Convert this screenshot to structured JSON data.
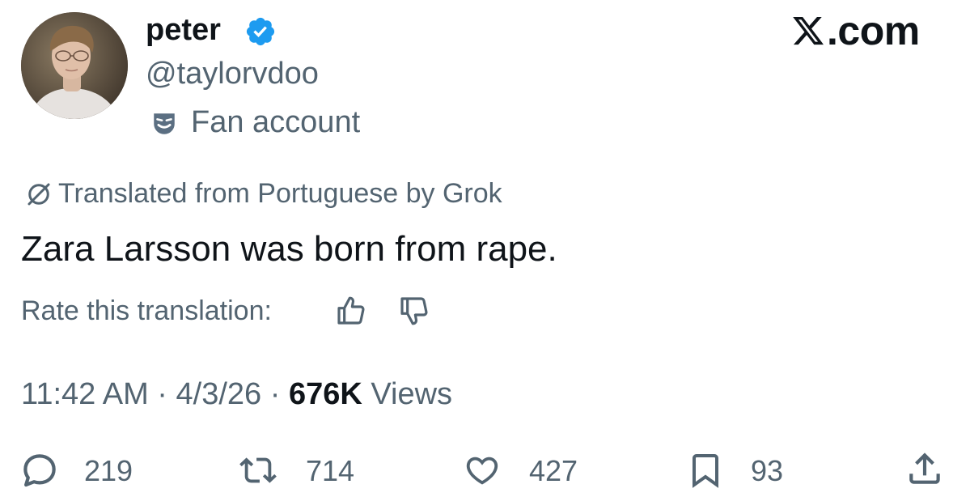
{
  "author": {
    "display_name": "peter",
    "handle": "@taylorvdoo",
    "verified": true,
    "verified_icon": "verified-badge-icon",
    "affiliation_label": "Fan account",
    "affiliation_icon": "theater-mask-icon"
  },
  "brand": {
    "logo_text": ".com",
    "logo_icon": "x-logo-icon"
  },
  "translation": {
    "label": "Translated from Portuguese by Grok",
    "icon": "grok-icon",
    "rate_label": "Rate this translation:",
    "thumbs_up_icon": "thumbs-up-icon",
    "thumbs_down_icon": "thumbs-down-icon"
  },
  "tweet": {
    "text": "Zara Larsson was born from rape."
  },
  "meta": {
    "time": "11:42 AM",
    "separator": " · ",
    "date": "4/3/26",
    "views_count": "676K",
    "views_label": " Views"
  },
  "actions": {
    "replies": "219",
    "retweets": "714",
    "likes": "427",
    "bookmarks": "93",
    "icons": [
      "reply-icon",
      "retweet-icon",
      "like-icon",
      "bookmark-icon",
      "share-icon"
    ]
  },
  "colors": {
    "text_primary": "#0f1419",
    "text_secondary": "#536471",
    "verified_blue": "#1d9bf0",
    "background": "#ffffff"
  }
}
